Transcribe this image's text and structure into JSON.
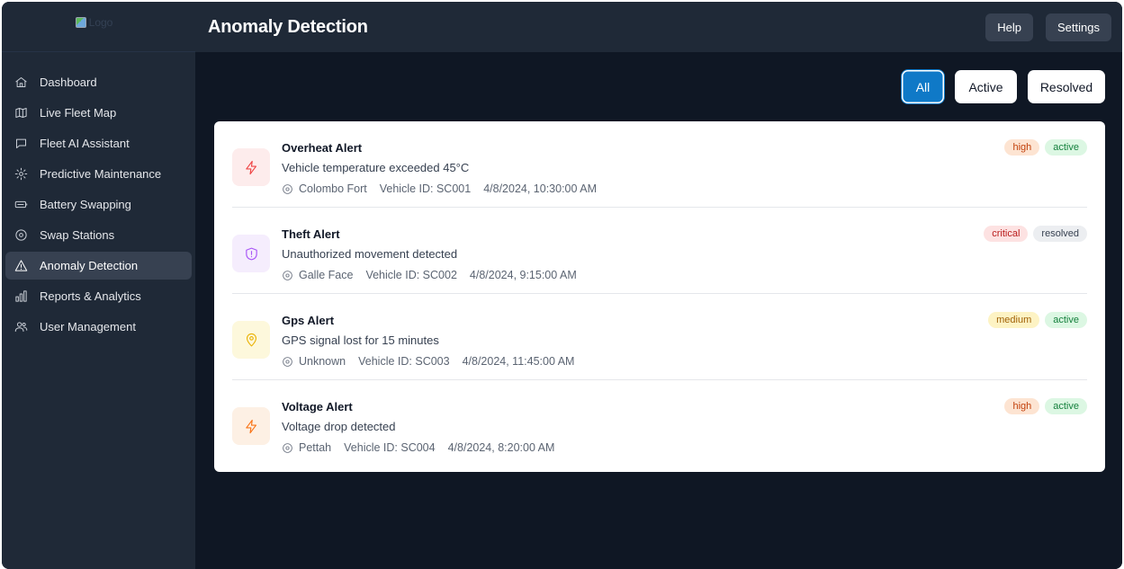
{
  "app": {
    "logo_alt": "Logo"
  },
  "header": {
    "title": "Anomaly Detection",
    "help_label": "Help",
    "settings_label": "Settings"
  },
  "sidebar": {
    "items": [
      {
        "label": "Dashboard",
        "icon": "home-icon",
        "active": false
      },
      {
        "label": "Live Fleet Map",
        "icon": "map-icon",
        "active": false
      },
      {
        "label": "Fleet AI Assistant",
        "icon": "chat-icon",
        "active": false
      },
      {
        "label": "Predictive Maintenance",
        "icon": "gear-icon",
        "active": false
      },
      {
        "label": "Battery Swapping",
        "icon": "battery-icon",
        "active": false
      },
      {
        "label": "Swap Stations",
        "icon": "location-icon",
        "active": false
      },
      {
        "label": "Anomaly Detection",
        "icon": "warning-icon",
        "active": true
      },
      {
        "label": "Reports & Analytics",
        "icon": "bar-chart-icon",
        "active": false
      },
      {
        "label": "User Management",
        "icon": "users-icon",
        "active": false
      }
    ]
  },
  "filters": {
    "all_label": "All",
    "active_label": "Active",
    "resolved_label": "Resolved",
    "selected": "All"
  },
  "alerts": [
    {
      "title": "Overheat Alert",
      "description": "Vehicle temperature exceeded 45°C",
      "location": "Colombo Fort",
      "vehicle": "Vehicle ID: SC001",
      "timestamp": "4/8/2024, 10:30:00 AM",
      "severity": "high",
      "status": "active",
      "icon": "lightning-icon"
    },
    {
      "title": "Theft Alert",
      "description": "Unauthorized movement detected",
      "location": "Galle Face",
      "vehicle": "Vehicle ID: SC002",
      "timestamp": "4/8/2024, 9:15:00 AM",
      "severity": "critical",
      "status": "resolved",
      "icon": "shield-alert-icon"
    },
    {
      "title": "Gps Alert",
      "description": "GPS signal lost for 15 minutes",
      "location": "Unknown",
      "vehicle": "Vehicle ID: SC003",
      "timestamp": "4/8/2024, 11:45:00 AM",
      "severity": "medium",
      "status": "active",
      "icon": "map-pin-icon"
    },
    {
      "title": "Voltage Alert",
      "description": "Voltage drop detected",
      "location": "Pettah",
      "vehicle": "Vehicle ID: SC004",
      "timestamp": "4/8/2024, 8:20:00 AM",
      "severity": "high",
      "status": "active",
      "icon": "lightning-icon"
    }
  ],
  "colors": {
    "sidebar_bg": "#1f2937",
    "main_bg": "#0f1724",
    "accent": "#0f79c7",
    "badge_high_bg": "#fde4d2",
    "badge_high_fg": "#c2410c",
    "badge_critical_bg": "#fde2e2",
    "badge_critical_fg": "#b91c1c",
    "badge_medium_bg": "#fdf3c4",
    "badge_medium_fg": "#a16207",
    "badge_active_bg": "#dcf7e3",
    "badge_active_fg": "#15803d",
    "badge_resolved_bg": "#eceef1",
    "badge_resolved_fg": "#374151"
  }
}
